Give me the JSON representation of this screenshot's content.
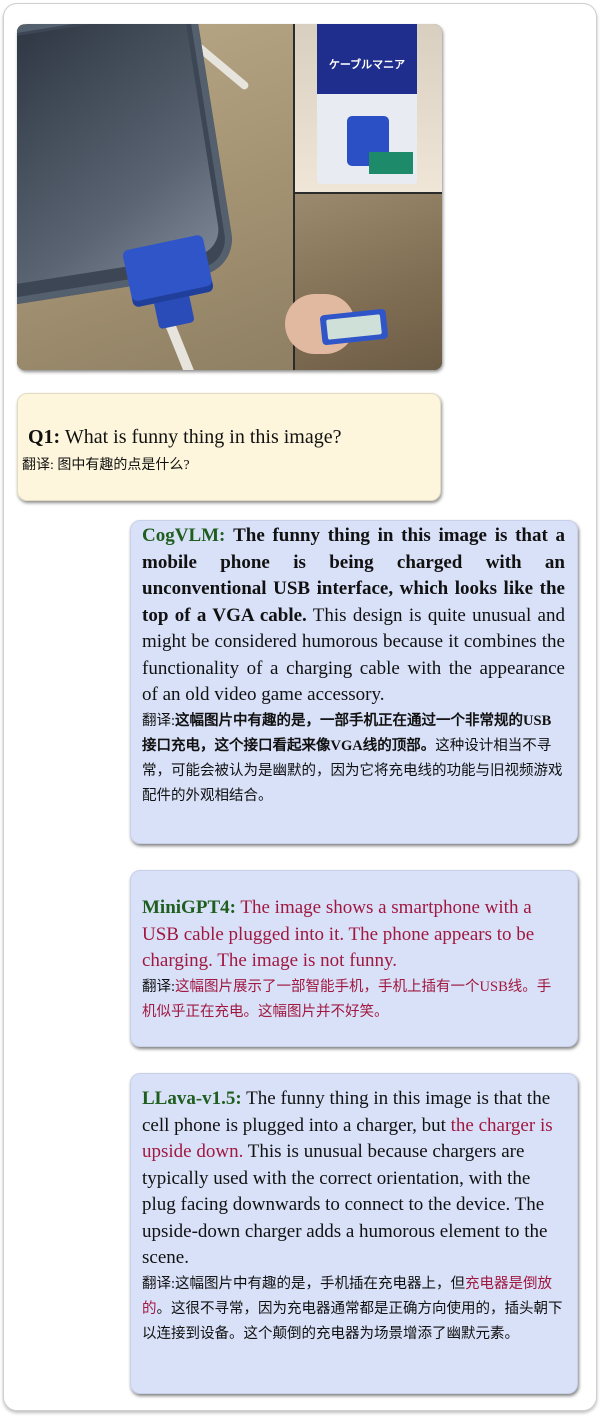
{
  "photo": {
    "description": "Smartphone charging with a blue VGA-style connector on a lightning cable; product package and close-up of connector",
    "package_text": "ケーブルマニア"
  },
  "question": {
    "label": "Q1:",
    "text": "What is funny thing in this image?",
    "translation_label": "翻译:",
    "translation": "图中有趣的点是什么?"
  },
  "answers": {
    "cogvlm": {
      "model": "CogVLM:",
      "en_bold": "The funny thing in this image is that a mobile phone is being charged with an unconventional USB interface, which looks like the top of a VGA cable.",
      "en_rest": "This design is quite unusual and might be considered humorous because it combines the functionality of a charging cable with the appearance of an old video game accessory.",
      "zh_label": "翻译:",
      "zh_bold": "这幅图片中有趣的是，一部手机正在通过一个非常规的USB接口充电，这个接口看起来像VGA线的顶部。",
      "zh_rest": "这种设计相当不寻常，可能会被认为是幽默的，因为它将充电线的功能与旧视频游戏配件的外观相结合。"
    },
    "minigpt4": {
      "model": "MiniGPT4:",
      "en": "The image shows a smartphone with a USB cable plugged into it. The phone appears to be charging. The image is not funny.",
      "zh_label": "翻译:",
      "zh": "这幅图片展示了一部智能手机，手机上插有一个USB线。手机似乎正在充电。这幅图片并不好笑。"
    },
    "llava": {
      "model": "LLava-v1.5:",
      "en_pre": "The funny thing in this image is that the cell phone is plugged into a charger, but",
      "en_red": "the charger is upside down.",
      "en_post": "This is unusual because chargers are typically used with the correct orientation, with the plug facing downwards to connect to the device. The upside-down charger adds a humorous element to the scene.",
      "zh_label": "翻译:",
      "zh_pre": "这幅图片中有趣的是，手机插在充电器上，但",
      "zh_red": "充电器是倒放的",
      "zh_post": "。这很不寻常，因为充电器通常都是正确方向使用的，插头朝下以连接到设备。这个颠倒的充电器为场景增添了幽默元素。"
    }
  },
  "colors": {
    "model_name": "#1e5e1e",
    "hallucination_red": "#a01840",
    "question_bg": "#fdf6dc",
    "answer_bg": "#d9e1f8"
  }
}
